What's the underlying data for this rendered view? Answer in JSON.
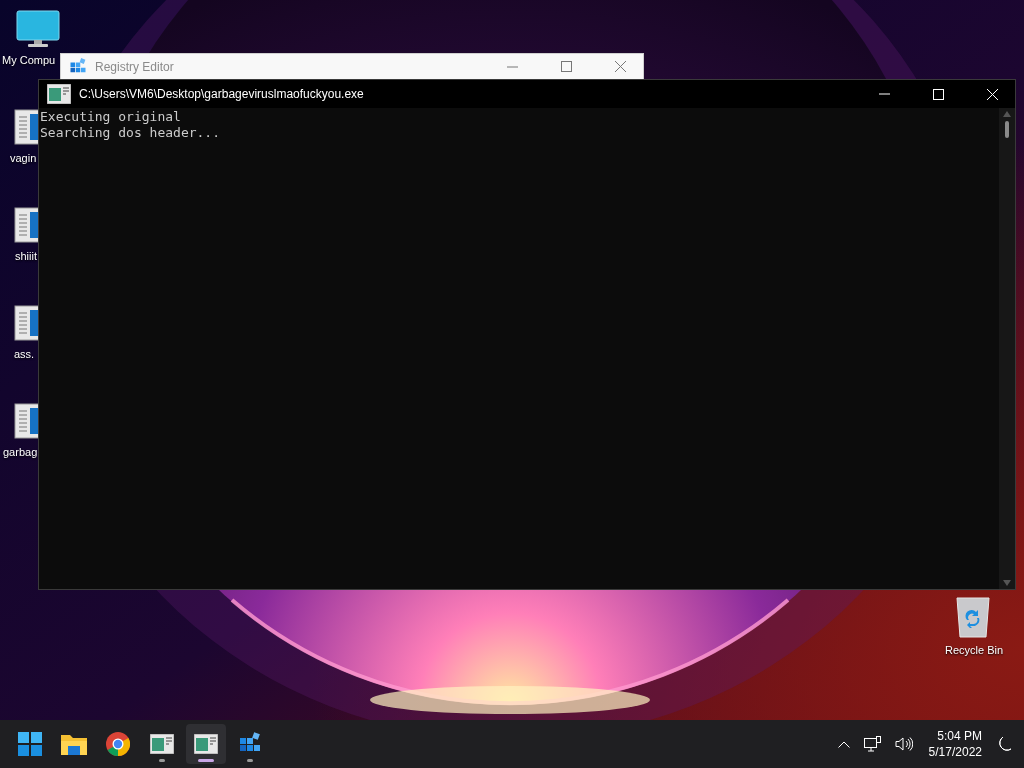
{
  "desktop_icons": [
    {
      "kind": "computer",
      "label": "My Compu"
    },
    {
      "kind": "file",
      "label": "vagin"
    },
    {
      "kind": "file",
      "label": "shiiit"
    },
    {
      "kind": "file",
      "label": "ass."
    },
    {
      "kind": "file",
      "label": "garbag"
    },
    {
      "kind": "recycle",
      "label": "Recycle Bin"
    }
  ],
  "windows": [
    {
      "kind": "regedit",
      "title": "Registry Editor"
    },
    {
      "kind": "console",
      "title": "C:\\Users\\VM6\\Desktop\\garbageviruslmaofuckyou.exe",
      "lines": [
        "Executing original",
        "Searching dos header..."
      ]
    }
  ],
  "taskbar": {
    "items": [
      {
        "kind": "start",
        "running": false,
        "selected": false
      },
      {
        "kind": "explorer",
        "running": false,
        "selected": false
      },
      {
        "kind": "chrome",
        "running": false,
        "selected": false
      },
      {
        "kind": "console",
        "running": true,
        "selected": false
      },
      {
        "kind": "console",
        "running": true,
        "selected": true
      },
      {
        "kind": "regedit",
        "running": true,
        "selected": false
      }
    ],
    "time": "5:04 PM",
    "date": "5/17/2022"
  }
}
